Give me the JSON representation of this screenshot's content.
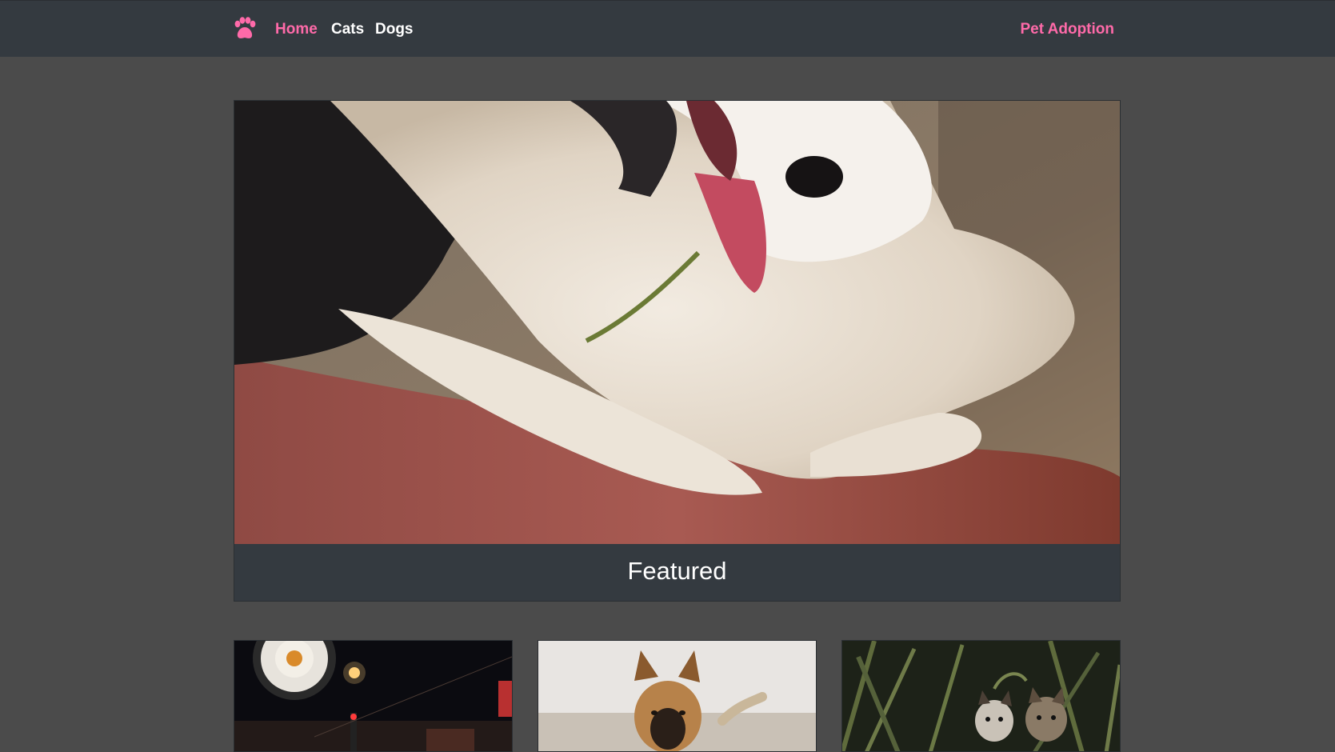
{
  "nav": {
    "home_label": "Home",
    "cats_label": "Cats",
    "dogs_label": "Dogs",
    "brand_label": "Pet Adoption",
    "brand_icon": "paw-icon"
  },
  "featured": {
    "caption": "Featured",
    "image": "husky-dog-photo"
  },
  "gallery": [
    {
      "image": "san-francisco-night-street-photo"
    },
    {
      "image": "german-shepherd-dog-photo"
    },
    {
      "image": "kittens-in-plants-photo"
    }
  ],
  "colors": {
    "accent": "#ff6aa9",
    "navbar_bg": "#343a40",
    "page_bg": "#4b4b4b"
  }
}
